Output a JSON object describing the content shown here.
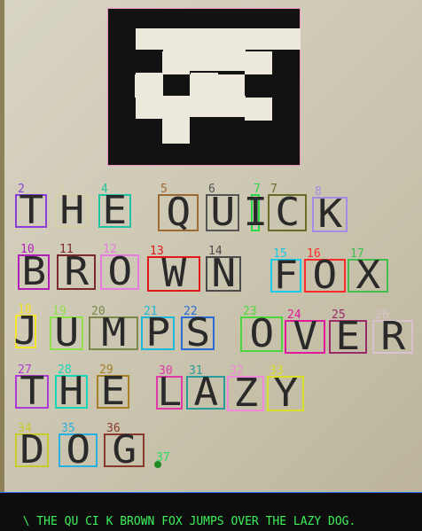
{
  "marker": {
    "cells": [
      [
        0,
        0,
        0,
        0,
        0
      ],
      [
        0,
        1,
        0,
        0,
        1
      ],
      [
        1,
        0,
        1,
        1,
        0
      ],
      [
        0,
        1,
        0,
        0,
        1
      ],
      [
        0,
        1,
        0,
        0,
        0
      ]
    ]
  },
  "letters": [
    {
      "num": "2",
      "ch": "T",
      "color": "#8b3fd8"
    },
    {
      "num": "3",
      "ch": "H",
      "color": "#d6cfa8"
    },
    {
      "num": "4",
      "ch": "E",
      "color": "#22c1a2"
    },
    {
      "num": "5",
      "ch": "Q",
      "color": "#9c6a35"
    },
    {
      "num": "6",
      "ch": "U",
      "color": "#555555"
    },
    {
      "num": "7",
      "ch": "I",
      "color": "#2ad84a"
    },
    {
      "num": "7",
      "ch": "C",
      "color": "#6b6b2a"
    },
    {
      "num": "8",
      "ch": "K",
      "color": "#a58ae6"
    },
    {
      "num": "10",
      "ch": "B",
      "color": "#b01fb8"
    },
    {
      "num": "11",
      "ch": "R",
      "color": "#7a2a2a"
    },
    {
      "num": "12",
      "ch": "O",
      "color": "#e67be0"
    },
    {
      "num": "13",
      "ch": "W",
      "color": "#e0181a"
    },
    {
      "num": "14",
      "ch": "N",
      "color": "#4b4b4b"
    },
    {
      "num": "15",
      "ch": "F",
      "color": "#19c9e6"
    },
    {
      "num": "16",
      "ch": "O",
      "color": "#ff2a2a"
    },
    {
      "num": "17",
      "ch": "X",
      "color": "#3fbf4f"
    },
    {
      "num": "18",
      "ch": "J",
      "color": "#f6e52b"
    },
    {
      "num": "19",
      "ch": "U",
      "color": "#8fe04a"
    },
    {
      "num": "20",
      "ch": "M",
      "color": "#7a8a4a"
    },
    {
      "num": "21",
      "ch": "P",
      "color": "#1fb8d6"
    },
    {
      "num": "22",
      "ch": "S",
      "color": "#2a6bd8"
    },
    {
      "num": "23",
      "ch": "O",
      "color": "#4cd83a"
    },
    {
      "num": "24",
      "ch": "V",
      "color": "#e0189a"
    },
    {
      "num": "25",
      "ch": "E",
      "color": "#9a2a6a"
    },
    {
      "num": "26",
      "ch": "R",
      "color": "#d8c2d0"
    },
    {
      "num": "27",
      "ch": "T",
      "color": "#b03ad8"
    },
    {
      "num": "28",
      "ch": "H",
      "color": "#1ad6b8"
    },
    {
      "num": "29",
      "ch": "E",
      "color": "#a8802a"
    },
    {
      "num": "30",
      "ch": "L",
      "color": "#e03aa8"
    },
    {
      "num": "31",
      "ch": "A",
      "color": "#2a9a9a"
    },
    {
      "num": "32",
      "ch": "Z",
      "color": "#f08ad8"
    },
    {
      "num": "33",
      "ch": "Y",
      "color": "#d8e02a"
    },
    {
      "num": "34",
      "ch": "D",
      "color": "#c8c82a"
    },
    {
      "num": "35",
      "ch": "O",
      "color": "#2ab0e0"
    },
    {
      "num": "36",
      "ch": "G",
      "color": "#8a3a2a"
    },
    {
      "num": "37",
      "ch": "",
      "color": "#2ae060"
    }
  ],
  "status": {
    "text": "\\ THE QU CI K BROWN FOX JUMPS OVER THE LAZY DOG."
  }
}
